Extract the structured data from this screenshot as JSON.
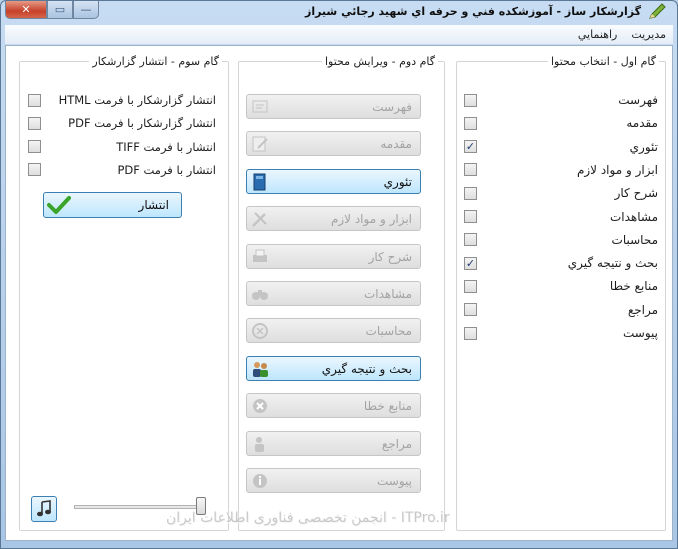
{
  "window": {
    "title": "گزارشکار ساز - آموزشکده فني و حرفه اي شهيد رجائي شيراز",
    "buttons": {
      "close": "✕",
      "maximize": "▭",
      "minimize": "—"
    }
  },
  "menu": [
    {
      "label": "مديريت"
    },
    {
      "label": "راهنمايي"
    }
  ],
  "step1": {
    "legend": "گام اول - انتخاب محتوا",
    "items": [
      {
        "label": "فهرست",
        "checked": false
      },
      {
        "label": "مقدمه",
        "checked": false
      },
      {
        "label": "تئوري",
        "checked": true
      },
      {
        "label": "ابزار و مواد لازم",
        "checked": false
      },
      {
        "label": "شرح کار",
        "checked": false
      },
      {
        "label": "مشاهدات",
        "checked": false
      },
      {
        "label": "محاسبات",
        "checked": false
      },
      {
        "label": "بحث و نتيجه گيري",
        "checked": true
      },
      {
        "label": "منابع خطا",
        "checked": false
      },
      {
        "label": "مراجع",
        "checked": false
      },
      {
        "label": "پيوست",
        "checked": false
      }
    ]
  },
  "step2": {
    "legend": "گام دوم - ويرايش محتوا",
    "buttons": [
      {
        "label": "فهرست",
        "enabled": false,
        "icon": "list-icon"
      },
      {
        "label": "مقدمه",
        "enabled": false,
        "icon": "edit-icon"
      },
      {
        "label": "تئوري",
        "enabled": true,
        "icon": "book-icon"
      },
      {
        "label": "ابزار و مواد لازم",
        "enabled": false,
        "icon": "tools-icon"
      },
      {
        "label": "شرح کار",
        "enabled": false,
        "icon": "printer-icon"
      },
      {
        "label": "مشاهدات",
        "enabled": false,
        "icon": "binoculars-icon"
      },
      {
        "label": "محاسبات",
        "enabled": false,
        "icon": "calculator-icon"
      },
      {
        "label": "بحث و نتيجه گيري",
        "enabled": true,
        "icon": "users-icon"
      },
      {
        "label": "منابع خطا",
        "enabled": false,
        "icon": "error-icon"
      },
      {
        "label": "مراجع",
        "enabled": false,
        "icon": "reference-icon"
      },
      {
        "label": "پيوست",
        "enabled": false,
        "icon": "info-icon"
      }
    ]
  },
  "step3": {
    "legend": "گام سوم - انتشار گزارشکار",
    "options": [
      {
        "label": "انتشار گزارشکار با فرمت HTML",
        "checked": false
      },
      {
        "label": "انتشار گزارشکار با فرمت PDF",
        "checked": false
      },
      {
        "label": "انتشار با فرمت TIFF",
        "checked": false
      },
      {
        "label": "انتشار با فرمت PDF",
        "checked": false
      }
    ],
    "publish_label": "انتشار",
    "volume_level": 1.0
  },
  "watermark": "ITPro.ir - انجمن تخصصی فناوری اطلاعات ایران",
  "colors": {
    "check": "#1d3a72",
    "active_button": "#bee6fd",
    "disabled_text": "#a3a3a3"
  }
}
